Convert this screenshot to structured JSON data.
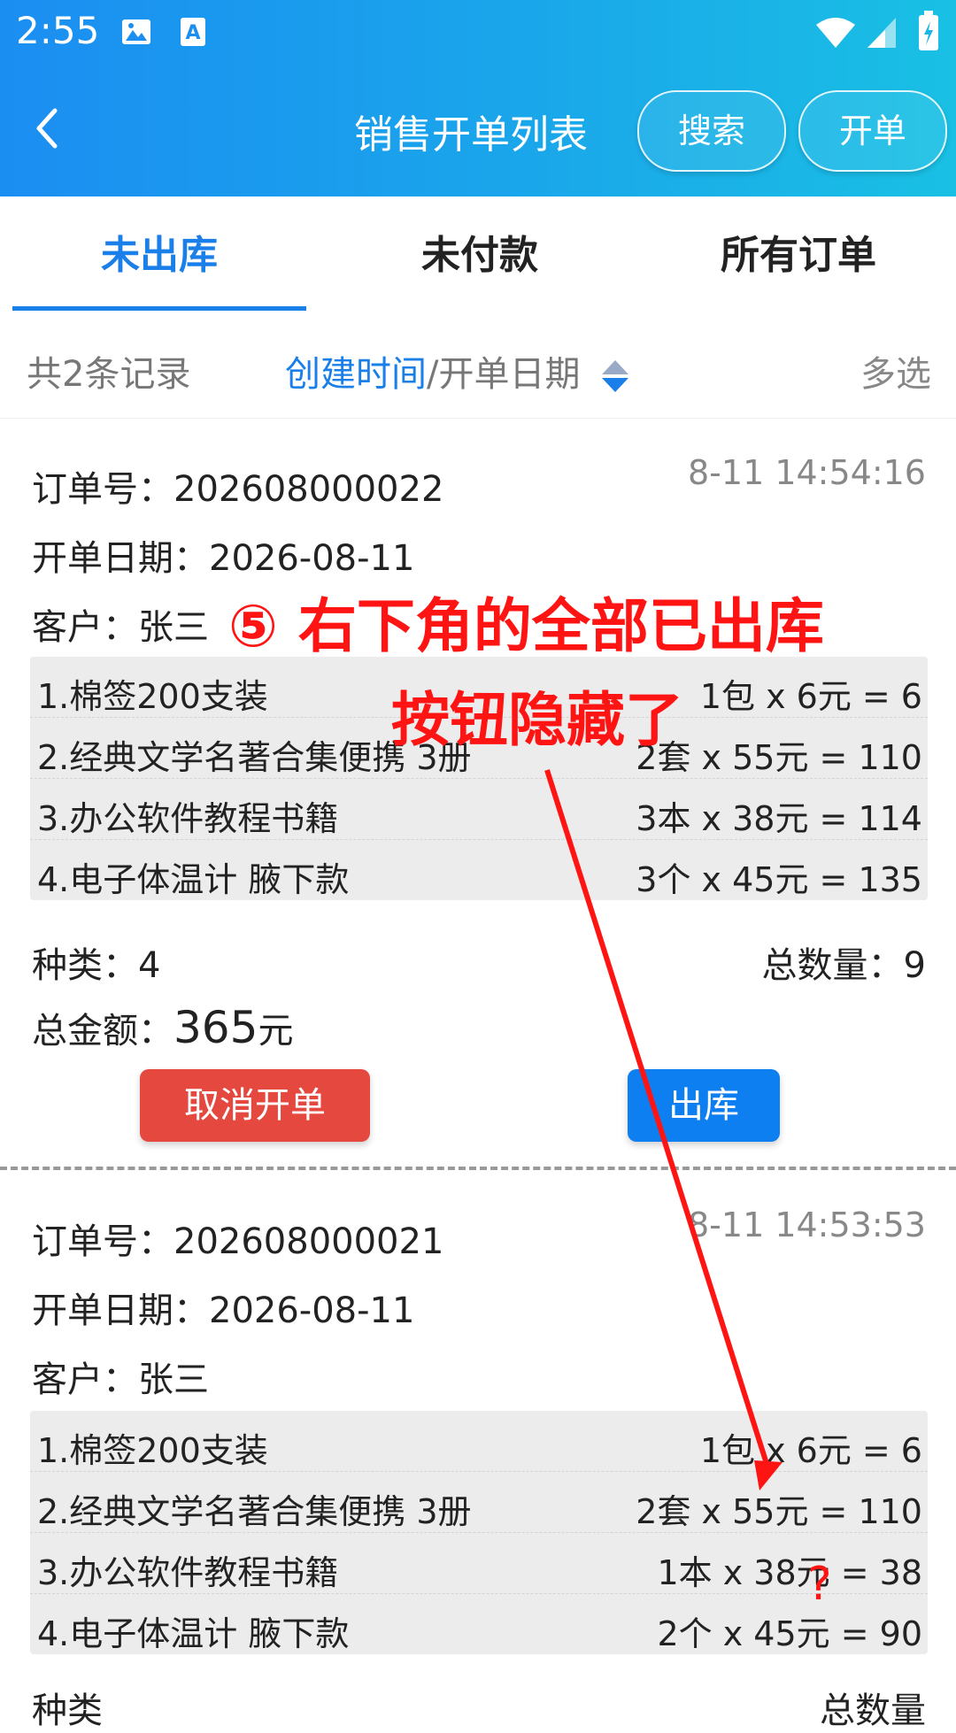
{
  "status_bar": {
    "time": "2:55"
  },
  "header": {
    "title": "销售开单列表",
    "search_label": "搜索",
    "create_label": "开单"
  },
  "tabs": [
    "未出库",
    "未付款",
    "所有订单"
  ],
  "sortbar": {
    "count": "共2条记录",
    "sort_active": "创建时间",
    "sort_sep": "/",
    "sort_other": "开单日期",
    "multi": "多选"
  },
  "orders": [
    {
      "order_no": "订单号：202608000022",
      "date": "开单日期：2026-08-11",
      "customer": "客户：张三",
      "time": "8-11 14:54:16",
      "items": [
        {
          "name": "1.棉签200支装",
          "price": "1包 x 6元 = 6"
        },
        {
          "name": "2.经典文学名著合集便携 3册",
          "price": "2套 x 55元 = 110"
        },
        {
          "name": "3.办公软件教程书籍",
          "price": "3本 x 38元 = 114"
        },
        {
          "name": "4.电子体温计 腋下款",
          "price": "3个 x 45元 = 135"
        }
      ],
      "kinds": "种类：4",
      "total_qty": "总数量：9",
      "total_amount_label": "总金额：",
      "total_amount": "365",
      "currency": "元",
      "cancel_label": "取消开单",
      "out_label": "出库"
    },
    {
      "order_no": "订单号：202608000021",
      "date": "开单日期：2026-08-11",
      "customer": "客户：张三",
      "time": "8-11 14:53:53",
      "items": [
        {
          "name": "1.棉签200支装",
          "price": "1包 x 6元 = 6"
        },
        {
          "name": "2.经典文学名著合集便携 3册",
          "price": "2套 x 55元 = 110"
        },
        {
          "name": "3.办公软件教程书籍",
          "price": "1本 x 38元 = 38"
        },
        {
          "name": "4.电子体温计 腋下款",
          "price": "2个 x 45元 = 90"
        }
      ],
      "kinds": "种类",
      "total_qty": "总数量"
    }
  ],
  "annotation": {
    "line1": "⑤ 右下角的全部已出库",
    "line2": "按钮隐藏了",
    "question": "?",
    "color": "#ff1414"
  },
  "colors": {
    "accent": "#1a7fe8",
    "cancel": "#e5483f",
    "primary_button": "#0d7ff0"
  }
}
